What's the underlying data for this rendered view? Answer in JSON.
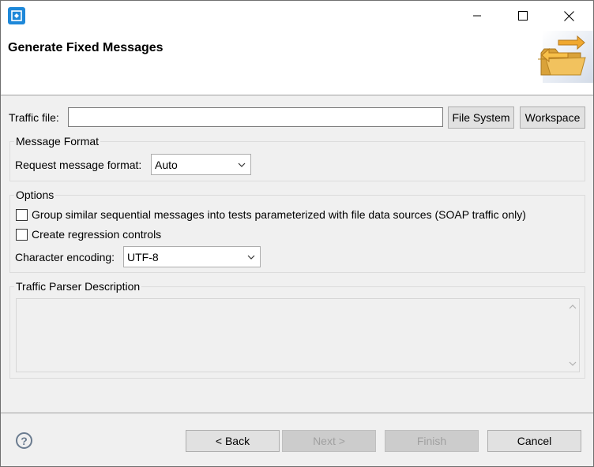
{
  "window": {
    "title": "Generate Fixed Messages"
  },
  "form": {
    "traffic_file_label": "Traffic file:",
    "traffic_file_value": "",
    "file_system_button": "File System",
    "workspace_button": "Workspace"
  },
  "message_format": {
    "title": "Message Format",
    "request_label": "Request message format:",
    "request_value": "Auto"
  },
  "options": {
    "title": "Options",
    "group_checkbox_label": "Group similar sequential messages into tests parameterized with file data sources (SOAP traffic only)",
    "regression_checkbox_label": "Create regression controls",
    "encoding_label": "Character encoding:",
    "encoding_value": "UTF-8"
  },
  "parser": {
    "title": "Traffic Parser Description",
    "description": ""
  },
  "footer": {
    "help": "?",
    "back_button": "< Back",
    "next_button": "Next >",
    "finish_button": "Finish",
    "cancel_button": "Cancel"
  },
  "colors": {
    "app_icon": "#1e88d9",
    "folder": "#e8b64a",
    "arrow": "#f0a830"
  }
}
